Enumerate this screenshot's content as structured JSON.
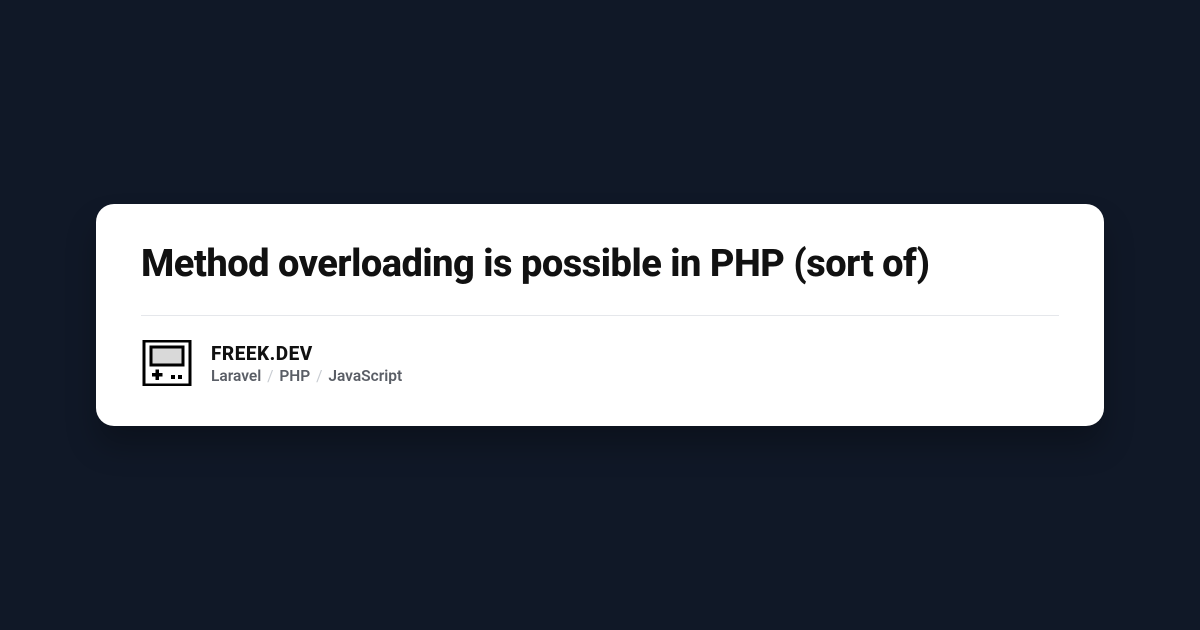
{
  "card": {
    "title": "Method overloading is possible in PHP (sort of)",
    "site_name": "FREEK.DEV",
    "tags": [
      "Laravel",
      "PHP",
      "JavaScript"
    ]
  },
  "colors": {
    "background": "#101827",
    "card_bg": "#ffffff",
    "text_primary": "#111111",
    "text_secondary": "#5a5e66",
    "separator": "#c8ccd2"
  },
  "icon": {
    "name": "gameboy-icon"
  }
}
